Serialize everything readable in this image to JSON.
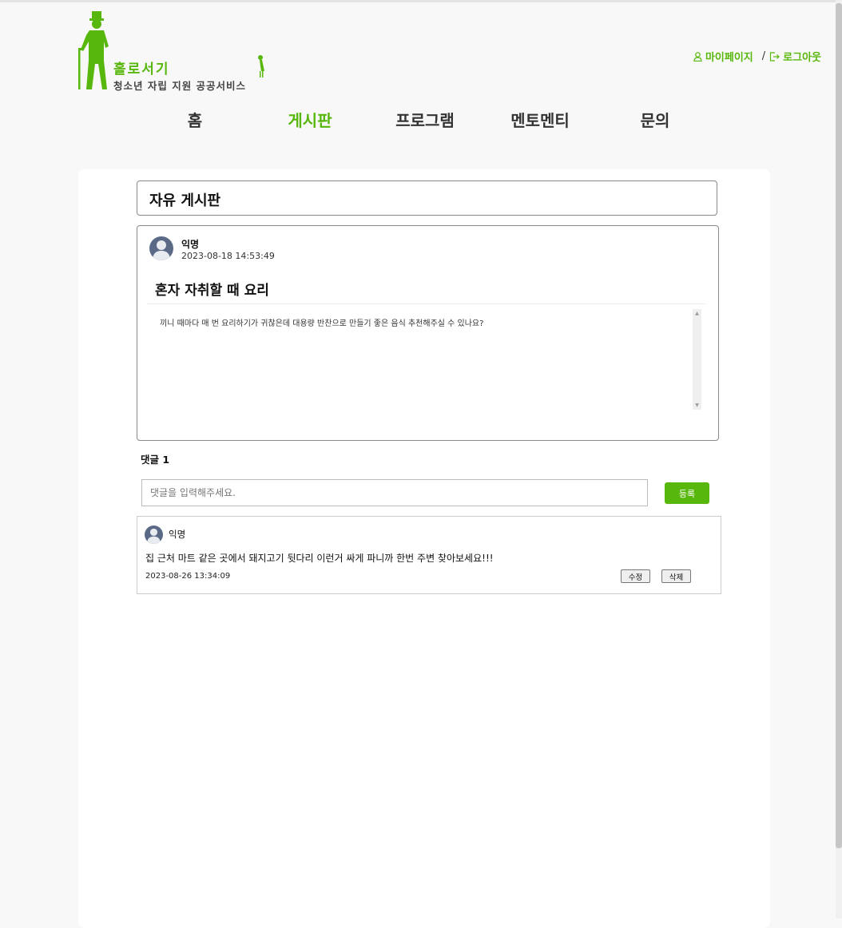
{
  "header": {
    "logo_title": "홀로서기",
    "logo_subtitle": "청소년 자립 지원 공공서비스",
    "mypage_label": "마이페이지",
    "separator": "/",
    "logout_label": "로그아웃"
  },
  "nav": {
    "tabs": [
      {
        "label": "홈",
        "active": false
      },
      {
        "label": "게시판",
        "active": true
      },
      {
        "label": "프로그램",
        "active": false
      },
      {
        "label": "멘토멘티",
        "active": false
      },
      {
        "label": "문의",
        "active": false
      }
    ]
  },
  "board": {
    "title": "자유 게시판"
  },
  "post": {
    "author": "익명",
    "date": "2023-08-18 14:53:49",
    "title": "혼자 자취할 때 요리",
    "body": "끼니 때마다 매 번 요리하기가 귀찮은데 대용량 반찬으로 만들기 좋은 음식 추천해주실 수 있나요?"
  },
  "comments": {
    "count_label": "댓글 1",
    "input_placeholder": "댓글을 입력해주세요.",
    "submit_label": "등록",
    "items": [
      {
        "author": "익명",
        "text": "집 근처 마트 같은 곳에서 돼지고기 뒷다리 이런거 싸게 파니까 한번 주변 찾아보세요!!!",
        "date": "2023-08-26 13:34:09",
        "edit_label": "수정",
        "delete_label": "삭제"
      }
    ]
  },
  "colors": {
    "accent": "#58b70c",
    "background": "#f8f8f8",
    "avatar": "#5a6a86"
  },
  "icons": {
    "mypage": "user-icon",
    "logout": "logout-icon",
    "logo": "gentleman-silhouette-logo"
  }
}
